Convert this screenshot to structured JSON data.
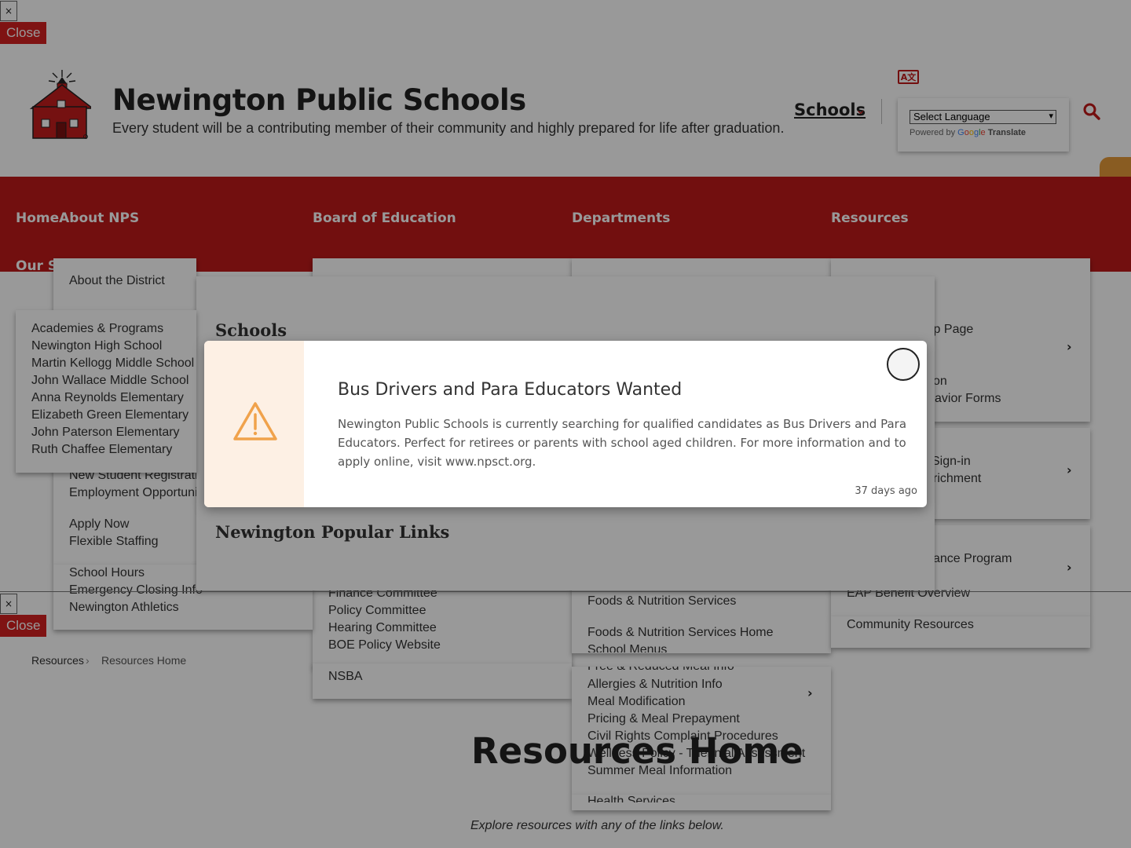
{
  "close_bars": {
    "x_label": "×",
    "close_label": "Close"
  },
  "header": {
    "title": "Newington Public Schools",
    "tagline": "Every student will be a contributing member of their community and highly prepared for life after graduation.",
    "schools_link": "Schools",
    "language": {
      "select_value": "Select Language",
      "powered_by": "Powered by",
      "google": "Google",
      "translate": "Translate"
    }
  },
  "nav": {
    "items": [
      "HomeAbout NPS",
      "Board of Education",
      "Departments",
      "Resources",
      "Our Sc"
    ]
  },
  "menus": {
    "about": {
      "about_district": "About the District",
      "employment": [
        "New Student Registratio",
        "Employment Opportuni"
      ],
      "apply": [
        "Apply Now",
        "Flexible Staffing"
      ],
      "hours": [
        "School Hours",
        "Emergency Closing Info",
        "Newington Athletics"
      ]
    },
    "schools_list": [
      "Academies & Programs",
      "Newington High School",
      "Martin Kellogg Middle School",
      "John Wallace Middle School",
      "Anna Reynolds Elementary",
      "Elizabeth Green Elementary",
      "John Paterson Elementary",
      "Ruth Chaffee Elementary"
    ],
    "mega": {
      "schools_heading": "Schools",
      "popular_heading": "Newington Popular Links"
    },
    "board": {
      "items": [
        "Finance Committee",
        "Policy Committee",
        "Hearing Committee",
        "BOE Policy Website"
      ],
      "nsba": "NSBA"
    },
    "departments": {
      "foods": "Foods & Nutrition Services",
      "foods_home": "Foods & Nutrition Services Home",
      "school_menus": "School Menus",
      "sub_items": [
        "Free & Reduced Meal Info",
        "Allergies & Nutrition Info",
        "Meal Modification",
        "Pricing & Meal Prepayment",
        "Civil Rights Complaint Procedures",
        "Wellness Policy - Triennial Assessment",
        "Summer Meal Information"
      ],
      "health": "Health Services"
    },
    "resources": {
      "help": "lp Page",
      "behavior": [
        "on",
        "avior Forms"
      ],
      "signin": [
        "Sign-in",
        "richment"
      ],
      "assistance": "ance Program",
      "eap": "EAP Benefit Overview",
      "community": "Community Resources"
    }
  },
  "breadcrumb": {
    "items": [
      "Resources",
      "Resources Home"
    ]
  },
  "page": {
    "title": "Resources Home",
    "subtitle": "Explore resources with any of the links below."
  },
  "modal": {
    "title": "Bus Drivers and Para Educators Wanted",
    "body": "Newington Public Schools is currently searching for qualified candidates as Bus Drivers and Para Educators. Perfect for retirees or parents with school aged children. For more information and to apply online, visit www.npsct.org.",
    "time": "37 days ago"
  },
  "colors": {
    "brand_red": "#be1a1a",
    "close_red": "#d42121",
    "warning_orange": "#f0a24b",
    "modal_side": "#fdf0e4"
  }
}
